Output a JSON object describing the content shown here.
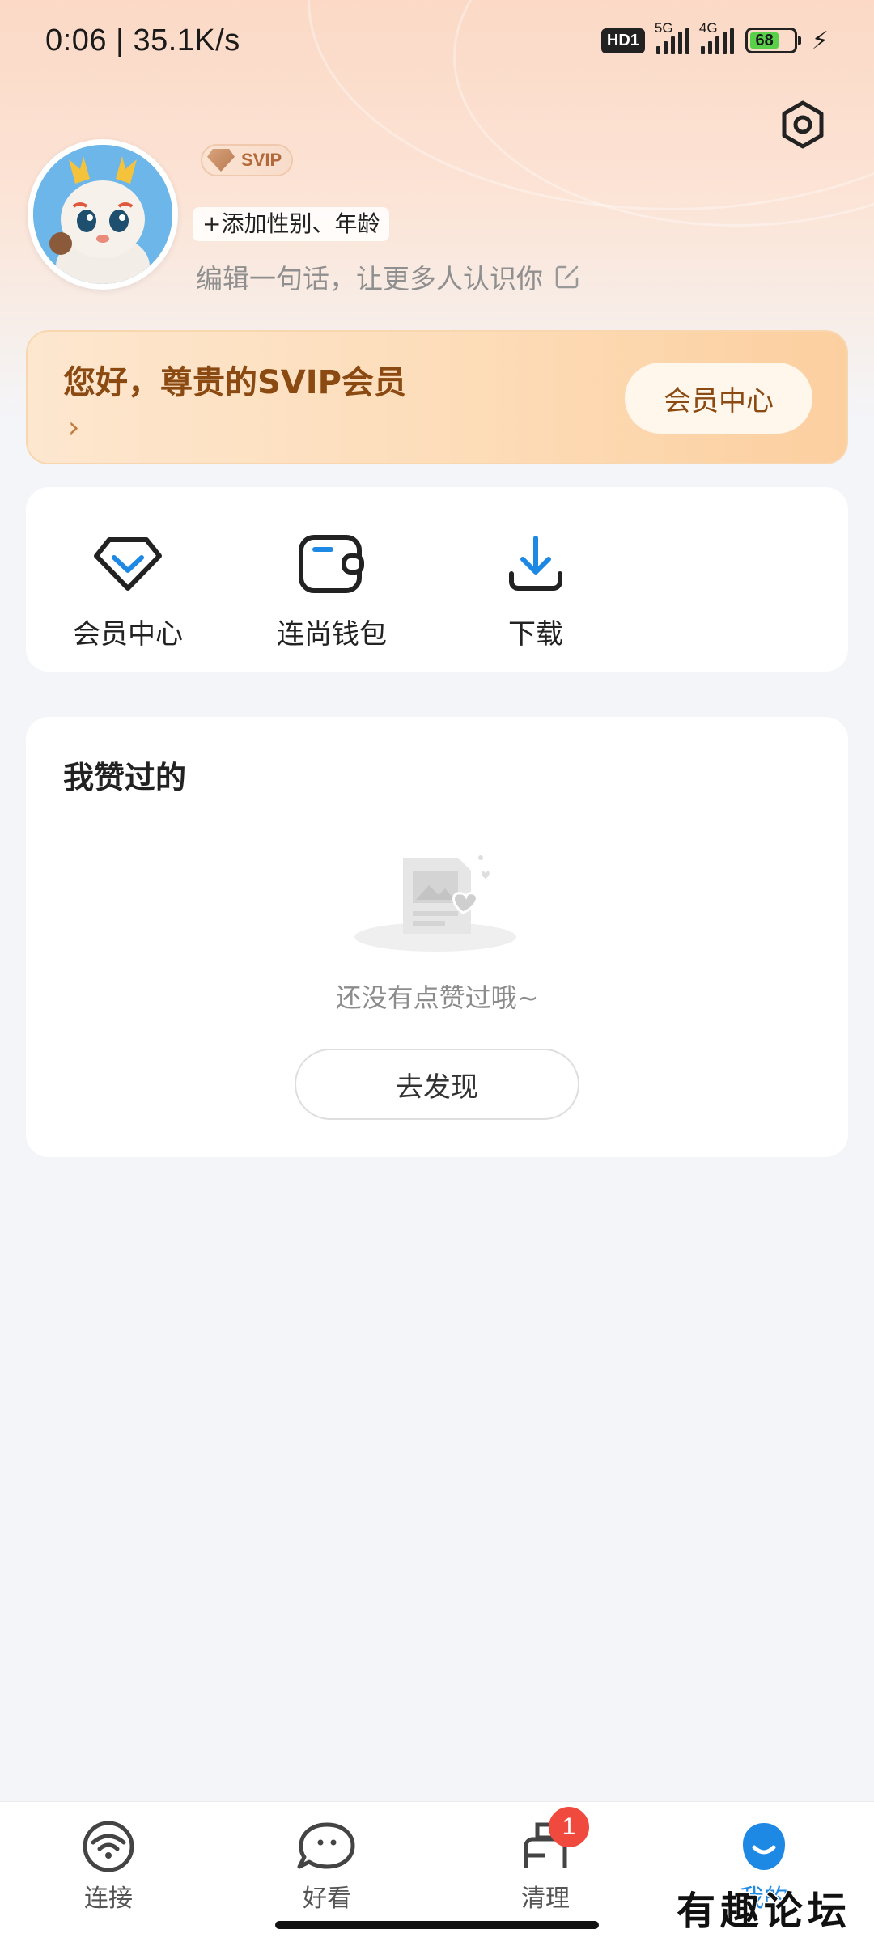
{
  "status_bar": {
    "time_speed": "0:06 | 35.1K/s",
    "hd_label": "HD1",
    "sim1_label": "5G",
    "sim2_label": "4G",
    "battery": "68"
  },
  "profile": {
    "svip_badge": "SVIP",
    "add_info": "+添加性别、年龄",
    "bio_placeholder": "编辑一句话，让更多人认识你"
  },
  "vip_banner": {
    "greeting": "您好，尊贵的SVIP会员",
    "arrow": "›",
    "button": "会员中心"
  },
  "quick_actions": [
    {
      "label": "会员中心",
      "icon": "diamond-icon"
    },
    {
      "label": "连尚钱包",
      "icon": "wallet-icon"
    },
    {
      "label": "下载",
      "icon": "download-icon"
    }
  ],
  "liked": {
    "title": "我赞过的",
    "empty_text": "还没有点赞过哦~",
    "button": "去发现"
  },
  "bottom_nav": {
    "items": [
      {
        "label": "连接",
        "icon": "wifi-icon"
      },
      {
        "label": "好看",
        "icon": "chat-bubble-icon"
      },
      {
        "label": "清理",
        "icon": "broom-icon",
        "badge": "1"
      },
      {
        "label": "我的",
        "icon": "profile-icon",
        "active": true
      }
    ]
  },
  "watermark": "有趣论坛",
  "colors": {
    "accent": "#1e88e5",
    "vip_text": "#8a4a12",
    "badge_red": "#f04a3e"
  }
}
